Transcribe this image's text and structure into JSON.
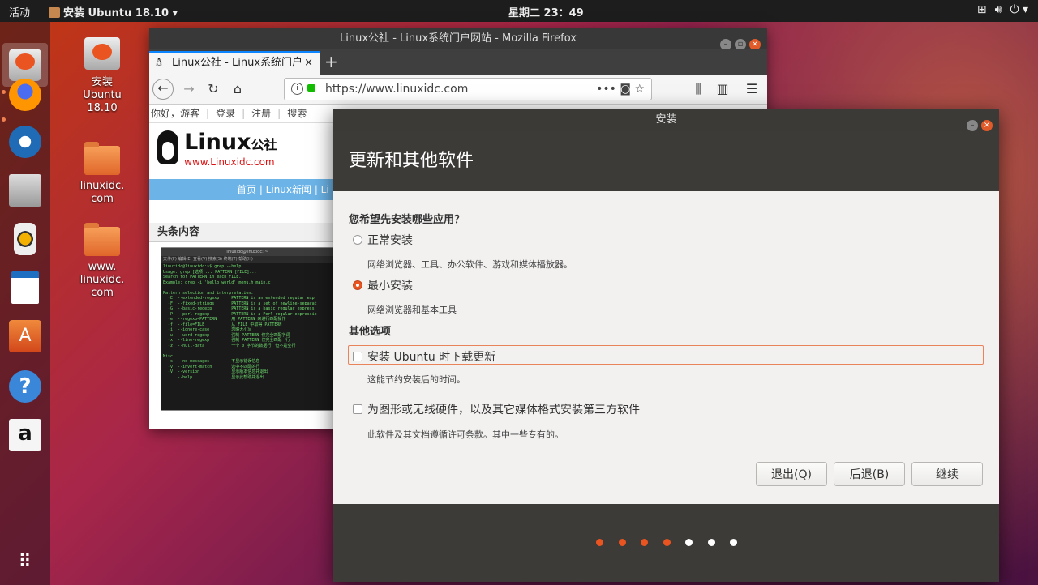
{
  "topbar": {
    "activities": "活动",
    "app_menu": "安装 Ubuntu 18.10 ▾",
    "clock": "星期二 23：49",
    "network_icon": "network-icon",
    "volume_icon": "volume-icon",
    "power_icon": "power-icon"
  },
  "dock": {
    "items": [
      "install-ubuntu-icon",
      "firefox-icon",
      "thunderbird-icon",
      "files-icon",
      "rhythmbox-icon",
      "writer-icon",
      "software-center-icon",
      "help-icon",
      "amazon-icon"
    ],
    "show_apps_icon": "show-apps-icon"
  },
  "desktop": {
    "icons": [
      {
        "label": "安装 Ubuntu 18.10"
      },
      {
        "label": "linuxidc. com"
      },
      {
        "label": "www. linuxidc. com"
      }
    ]
  },
  "firefox": {
    "window_title": "Linux公社 - Linux系统门户网站 - Mozilla Firefox",
    "tab_title": "Linux公社 - Linux系统门户",
    "new_tab": "+",
    "url": "https://www.linuxidc.com",
    "page": {
      "topnav": [
        "你好，游客",
        "登录",
        "注册",
        "搜索"
      ],
      "logo_text": "Linux",
      "logo_suffix": "公社",
      "logo_site": "www.Linuxidc.com",
      "nav_items": "首页 | Linux新闻 | Li",
      "section_title": "头条内容",
      "screenshot_title": "linuxidc@linuxidc: ~",
      "screenshot_menu": "文件(F) 编辑(E) 查看(V) 搜索(S) 终端(T) 帮助(H)",
      "screenshot_text": "linuxidc@linuxidc:~$ grep --help\nUsage: grep [选项]... PATTERN [FILE]...\nSearch for PATTERN in each FILE.\nExample: grep -i 'hello world' menu.h main.c\n\nPattern selection and interpretation:\n  -E, --extended-regexp     PATTERN is an extended regular expr\n  -F, --fixed-strings       PATTERN is a set of newline-separat\n  -G, --basic-regexp        PATTERN is a basic regular express\n  -P, --perl-regexp         PATTERN is a Perl regular expressio\n  -e, --regexp=PATTERN      用 PATTERN 来进行匹配操作\n  -f, --file=FILE           从 FILE 中取得 PATTERN\n  -i, --ignore-case         忽略大小写\n  -w, --word-regexp         强制 PATTERN 仅完全匹配字词\n  -x, --line-regexp         强制 PATTERN 仅完全匹配一行\n  -z, --null-data           一个 0 字节的数据行，但不是空行\n\nMisc:\n  -s, --no-messages         不显示错误信息\n  -v, --invert-match        选中不匹配的行\n  -V, --version             显示版本信息并退出\n      --help                显示此帮助并退出"
    }
  },
  "installer": {
    "window_title": "安装",
    "header": "更新和其他软件",
    "question": "您希望先安装哪些应用？",
    "options": [
      {
        "label": "正常安装",
        "desc": "网络浏览器、工具、办公软件、游戏和媒体播放器。",
        "selected": false
      },
      {
        "label": "最小安装",
        "desc": "网络浏览器和基本工具",
        "selected": true
      }
    ],
    "other_title": "其他选项",
    "checkboxes": [
      {
        "label": "安装 Ubuntu 时下载更新",
        "desc": "这能节约安装后的时间。",
        "checked": false
      },
      {
        "label": "为图形或无线硬件，以及其它媒体格式安装第三方软件",
        "desc": "此软件及其文档遵循许可条款。其中一些专有的。",
        "checked": false
      }
    ],
    "buttons": {
      "quit": "退出(Q)",
      "back": "后退(B)",
      "continue": "继续"
    },
    "progress": {
      "completed_steps": 4,
      "total_steps": 7
    },
    "colors": {
      "accent": "#e95420",
      "dot_inactive": "#ffffff"
    }
  }
}
